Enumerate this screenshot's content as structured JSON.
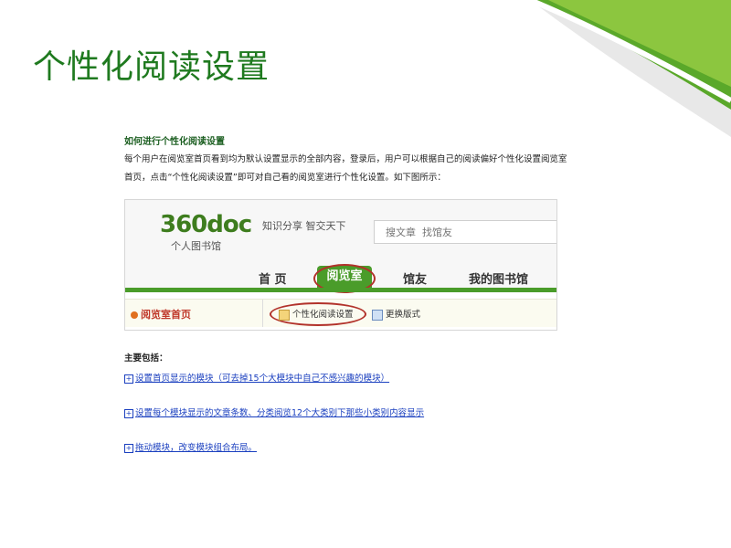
{
  "slide": {
    "title": "个性化阅读设置"
  },
  "help": {
    "title": "如何进行个性化阅读设置",
    "desc_line1": "每个用户在阅览室首页看到均为默认设置显示的全部内容，登录后，用户可以根据自己的阅读偏好个性化设置阅览室",
    "desc_line2": "首页，点击“个性化阅读设置”即可对自己看的阅览室进行个性化设置。如下图所示："
  },
  "shot": {
    "logo": "360doc",
    "logo_sub": "个人图书馆",
    "slogan": "知识分享  智交天下",
    "search_placeholder": "搜文章  找馆友",
    "nav": [
      "首 页",
      "阅览室",
      "馆友",
      "我的图书馆"
    ],
    "home_link": "阅览室首页",
    "option1": "个性化阅读设置",
    "option2": "更换版式"
  },
  "list": {
    "heading": "主要包括：",
    "items": [
      "设置首页显示的模块（可去掉15个大模块中自己不感兴趣的模块）",
      "设置每个模块显示的文章条数、分类阅览12个大类别下那些小类别内容显示",
      "拖动模块，改变模块组合布局。"
    ]
  },
  "colors": {
    "title_green": "#1f7a1f",
    "nav_green": "#4a9c2a",
    "highlight_red": "#b2322b",
    "link_blue": "#1a3fbf"
  }
}
